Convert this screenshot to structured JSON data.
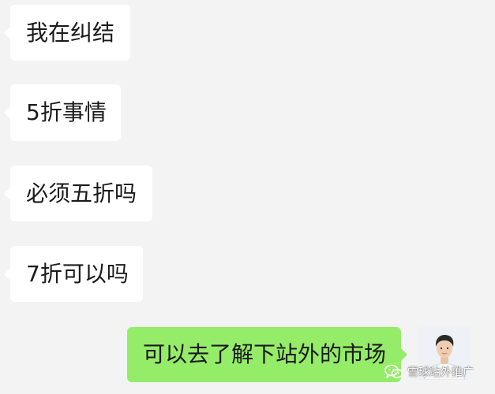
{
  "messages": [
    {
      "direction": "incoming",
      "text": "我在纠结"
    },
    {
      "direction": "incoming",
      "text": "5折事情"
    },
    {
      "direction": "incoming",
      "text": "必须五折吗"
    },
    {
      "direction": "incoming",
      "text": "7折可以吗"
    },
    {
      "direction": "outgoing",
      "text": "可以去了解下站外的市场"
    }
  ],
  "watermark": {
    "text": "雪球站外推广",
    "icon": "wechat-icon"
  },
  "avatar": {
    "icon": "avatar-photo"
  },
  "colors": {
    "background": "#f3f3f3",
    "incoming_bubble": "#ffffff",
    "outgoing_bubble": "#95ec69",
    "text": "#1a1a1a"
  }
}
